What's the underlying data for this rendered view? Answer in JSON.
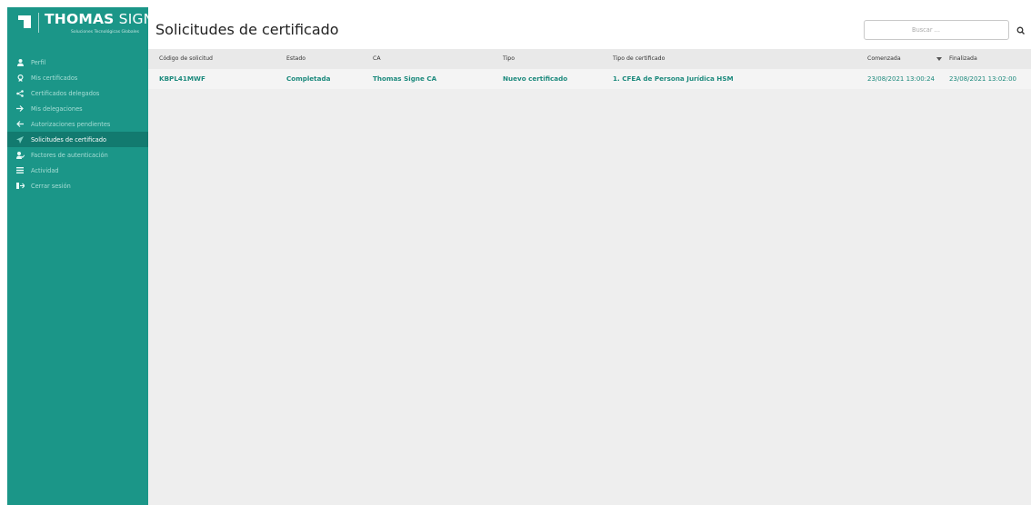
{
  "brand": {
    "name_bold": "THOMAS",
    "name_light": "SIGNE",
    "tagline": "Soluciones Tecnológicas Globales"
  },
  "sidebar": {
    "items": [
      {
        "label": "Perfil",
        "icon": "user-icon"
      },
      {
        "label": "Mis certificados",
        "icon": "certificate-icon"
      },
      {
        "label": "Certificados delegados",
        "icon": "share-icon"
      },
      {
        "label": "Mis delegaciones",
        "icon": "arrow-right-icon"
      },
      {
        "label": "Autorizaciones pendientes",
        "icon": "arrow-left-icon"
      },
      {
        "label": "Solicitudes de certificado",
        "icon": "send-icon",
        "active": true
      },
      {
        "label": "Factores de autenticación",
        "icon": "user-check-icon"
      },
      {
        "label": "Actividad",
        "icon": "list-icon"
      },
      {
        "label": "Cerrar sesión",
        "icon": "logout-icon"
      }
    ]
  },
  "header": {
    "title": "Solicitudes de certificado",
    "search_placeholder": "Buscar ..."
  },
  "table": {
    "columns": [
      "Código de solicitud",
      "Estado",
      "CA",
      "Tipo",
      "Tipo de certificado",
      "Comenzada",
      "Finalizada"
    ],
    "sort_column": "Comenzada",
    "sort_direction": "desc",
    "rows": [
      {
        "codigo": "KBPL41MWF",
        "estado": "Completada",
        "ca": "Thomas Signe CA",
        "tipo": "Nuevo certificado",
        "tipo_certificado": "1. CFEA de Persona Jurídica HSM",
        "comenzada": "23/08/2021 13:00:24",
        "finalizada": "23/08/2021 13:02:00"
      }
    ]
  },
  "colors": {
    "sidebar": "#1b9688",
    "sidebar_active": "#127a6f",
    "accent_text": "#1d8a7d"
  }
}
